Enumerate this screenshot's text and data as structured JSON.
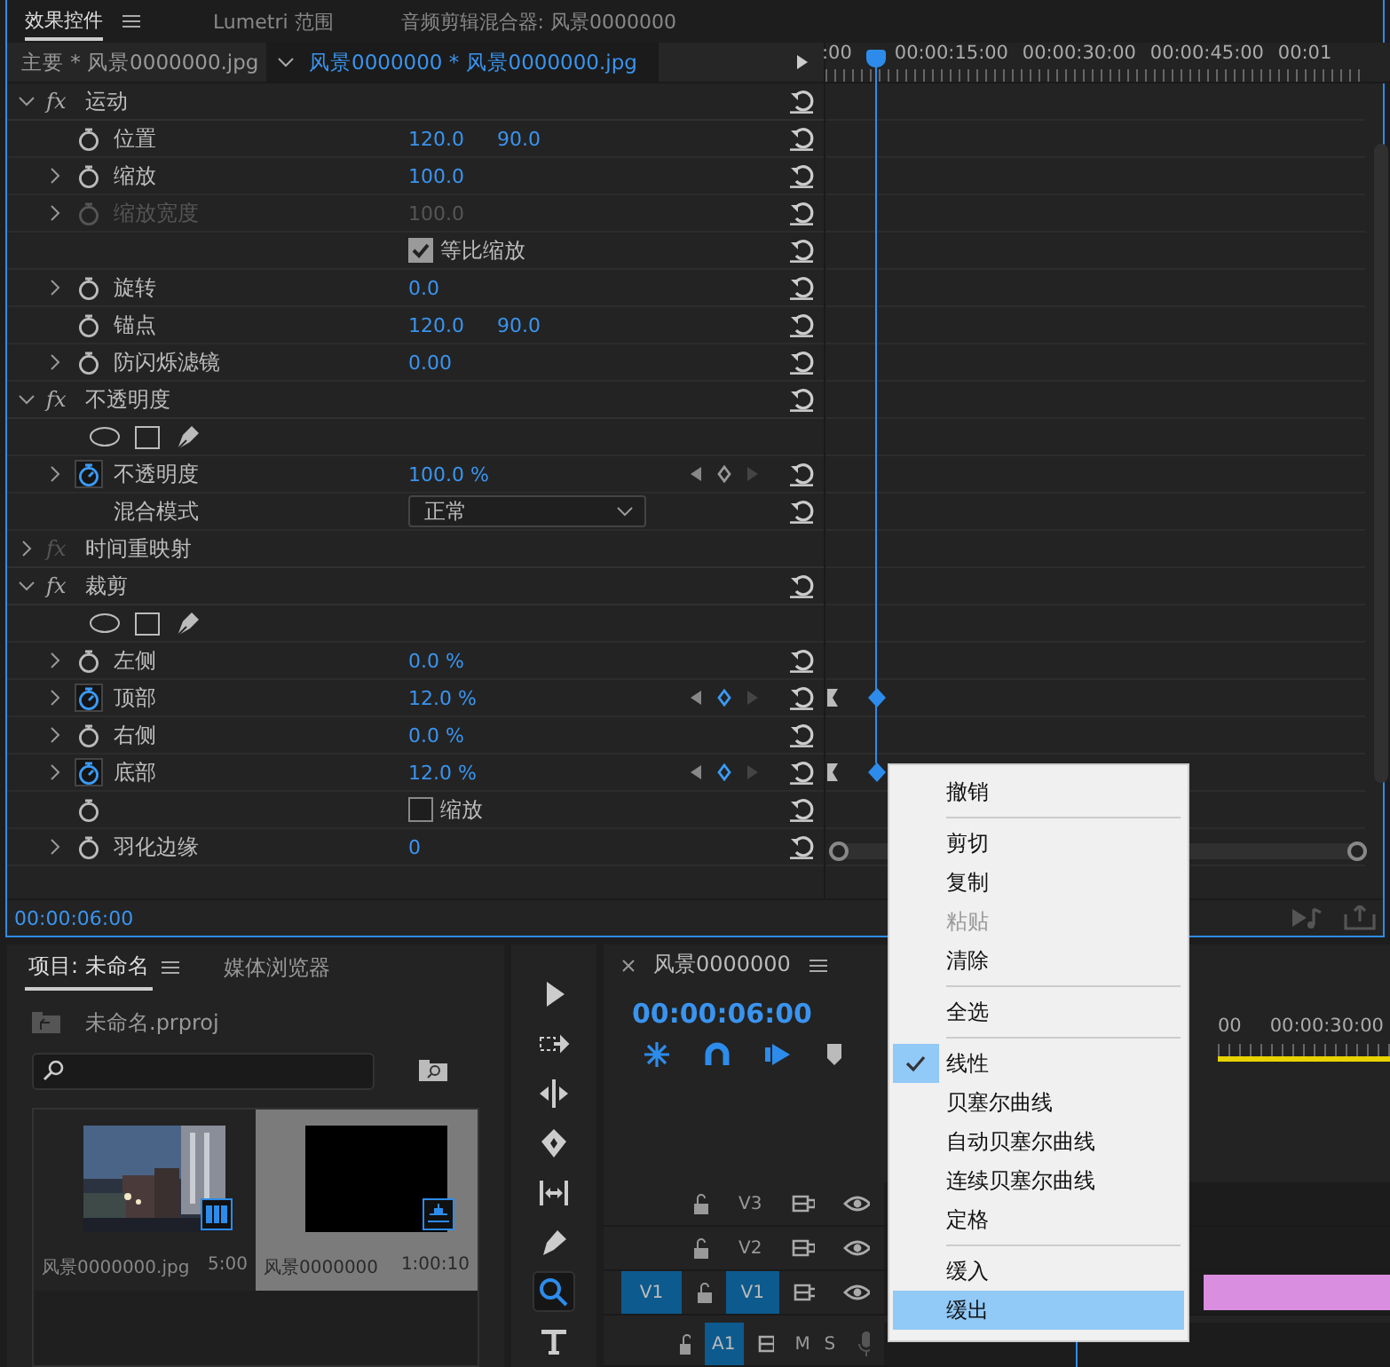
{
  "panel_tabs": [
    {
      "label": "效果控件",
      "selected": true
    },
    {
      "label": "Lumetri 范围",
      "selected": false
    },
    {
      "label": "音频剪辑混合器: 风景0000000",
      "selected": false
    }
  ],
  "clip_header": {
    "master": "主要 * 风景0000000.jpg",
    "sequence": "风景0000000 * 风景0000000.jpg"
  },
  "ruler": [
    ":00",
    "00:00:15:00",
    "00:00:30:00",
    "00:00:45:00",
    "00:01"
  ],
  "effects": [
    {
      "kind": "header",
      "label": "运动",
      "fx": "fx",
      "fx_enabled": true,
      "expanded": true,
      "reset": true
    },
    {
      "kind": "param",
      "label": "位置",
      "values": [
        "120.0",
        "90.0"
      ],
      "expandable": false,
      "animated": false,
      "disabled": false,
      "keyframes": false,
      "at_keyframe": false,
      "reset": true
    },
    {
      "kind": "param",
      "label": "缩放",
      "values": [
        "100.0"
      ],
      "expandable": true,
      "animated": false,
      "disabled": false,
      "keyframes": false,
      "at_keyframe": false,
      "reset": true
    },
    {
      "kind": "param",
      "label": "缩放宽度",
      "values": [
        "100.0"
      ],
      "expandable": true,
      "animated": false,
      "disabled": true,
      "keyframes": false,
      "at_keyframe": false,
      "reset": true
    },
    {
      "kind": "checkbox",
      "label": "等比缩放",
      "checked": true,
      "stopwatch": false,
      "reset": true
    },
    {
      "kind": "param",
      "label": "旋转",
      "values": [
        "0.0"
      ],
      "expandable": true,
      "animated": false,
      "disabled": false,
      "keyframes": false,
      "at_keyframe": false,
      "reset": true
    },
    {
      "kind": "param",
      "label": "锚点",
      "values": [
        "120.0",
        "90.0"
      ],
      "expandable": false,
      "animated": false,
      "disabled": false,
      "keyframes": false,
      "at_keyframe": false,
      "reset": true
    },
    {
      "kind": "param",
      "label": "防闪烁滤镜",
      "values": [
        "0.00"
      ],
      "expandable": true,
      "animated": false,
      "disabled": false,
      "keyframes": false,
      "at_keyframe": false,
      "reset": true
    },
    {
      "kind": "header",
      "label": "不透明度",
      "fx": "fx",
      "fx_enabled": true,
      "expanded": true,
      "reset": true
    },
    {
      "kind": "masks"
    },
    {
      "kind": "param",
      "label": "不透明度",
      "values": [
        "100.0 %"
      ],
      "expandable": true,
      "animated": true,
      "disabled": false,
      "keyframes": true,
      "at_keyframe": false,
      "reset": true
    },
    {
      "kind": "dropdown",
      "label": "混合模式",
      "value": "正常",
      "reset": true
    },
    {
      "kind": "header",
      "label": "时间重映射",
      "fx": "fx",
      "fx_enabled": false,
      "expanded": false
    },
    {
      "kind": "header",
      "label": "裁剪",
      "fx": "fx",
      "fx_enabled": true,
      "expanded": true,
      "reset": true
    },
    {
      "kind": "masks"
    },
    {
      "kind": "param",
      "label": "左侧",
      "values": [
        "0.0 %"
      ],
      "expandable": true,
      "animated": false,
      "disabled": false,
      "keyframes": false,
      "at_keyframe": false,
      "reset": true
    },
    {
      "kind": "param",
      "label": "顶部",
      "values": [
        "12.0 %"
      ],
      "expandable": true,
      "animated": true,
      "disabled": false,
      "keyframes": true,
      "at_keyframe": true,
      "reset": true
    },
    {
      "kind": "param",
      "label": "右侧",
      "values": [
        "0.0 %"
      ],
      "expandable": true,
      "animated": false,
      "disabled": false,
      "keyframes": false,
      "at_keyframe": false,
      "reset": true
    },
    {
      "kind": "param",
      "label": "底部",
      "values": [
        "12.0 %"
      ],
      "expandable": true,
      "animated": true,
      "disabled": false,
      "keyframes": true,
      "at_keyframe": true,
      "reset": true
    },
    {
      "kind": "checkbox",
      "label": "缩放",
      "checked": false,
      "stopwatch": true,
      "reset": true
    },
    {
      "kind": "param",
      "label": "羽化边缘",
      "values": [
        "0"
      ],
      "expandable": true,
      "animated": false,
      "disabled": false,
      "keyframes": false,
      "at_keyframe": false,
      "reset": true
    }
  ],
  "current_time": "00:00:06:00",
  "project": {
    "tabs": [
      {
        "label": "项目: 未命名",
        "selected": true
      },
      {
        "label": "媒体浏览器",
        "selected": false
      }
    ],
    "file": "未命名.prproj",
    "items": [
      {
        "name": "风景0000000.jpg",
        "duration": "5:00",
        "selected": false
      },
      {
        "kind": "sequence",
        "name": "风景0000000",
        "duration": "1:00:10",
        "selected": true
      }
    ]
  },
  "tools": [
    {
      "kind": "selection",
      "selected": false
    },
    {
      "kind": "track-select",
      "selected": false
    },
    {
      "kind": "ripple",
      "selected": false
    },
    {
      "kind": "razor",
      "selected": false
    },
    {
      "kind": "slip",
      "selected": false
    },
    {
      "kind": "pen",
      "selected": false
    },
    {
      "kind": "zoom",
      "selected": true
    },
    {
      "kind": "type",
      "selected": false
    }
  ],
  "timeline": {
    "tab": "风景0000000",
    "timecode": "00:00:06:00",
    "ruler": [
      "00",
      "00:00:30:00"
    ],
    "tracks": [
      {
        "kind": "video",
        "name": "V3",
        "targeted": false
      },
      {
        "kind": "video",
        "name": "V2",
        "targeted": false
      },
      {
        "kind": "video",
        "name": "V1",
        "targeted": true,
        "source_patch": "V1",
        "clip": true
      },
      {
        "kind": "audio",
        "name": "A1",
        "targeted": true,
        "mute": "M",
        "solo": "S"
      }
    ]
  },
  "context_menu": [
    {
      "kind": "item",
      "label": "撤销",
      "checked": false,
      "disabled": false,
      "selected": false
    },
    {
      "kind": "separator"
    },
    {
      "kind": "item",
      "label": "剪切",
      "checked": false,
      "disabled": false,
      "selected": false
    },
    {
      "kind": "item",
      "label": "复制",
      "checked": false,
      "disabled": false,
      "selected": false
    },
    {
      "kind": "item",
      "label": "粘贴",
      "checked": false,
      "disabled": true,
      "selected": false
    },
    {
      "kind": "item",
      "label": "清除",
      "checked": false,
      "disabled": false,
      "selected": false
    },
    {
      "kind": "separator"
    },
    {
      "kind": "item",
      "label": "全选",
      "checked": false,
      "disabled": false,
      "selected": false
    },
    {
      "kind": "separator"
    },
    {
      "kind": "item",
      "label": "线性",
      "checked": true,
      "disabled": false,
      "selected": false
    },
    {
      "kind": "item",
      "label": "贝塞尔曲线",
      "checked": false,
      "disabled": false,
      "selected": false
    },
    {
      "kind": "item",
      "label": "自动贝塞尔曲线",
      "checked": false,
      "disabled": false,
      "selected": false
    },
    {
      "kind": "item",
      "label": "连续贝塞尔曲线",
      "checked": false,
      "disabled": false,
      "selected": false
    },
    {
      "kind": "item",
      "label": "定格",
      "checked": false,
      "disabled": false,
      "selected": false
    },
    {
      "kind": "separator"
    },
    {
      "kind": "item",
      "label": "缓入",
      "checked": false,
      "disabled": false,
      "selected": false
    },
    {
      "kind": "item",
      "label": "缓出",
      "checked": false,
      "disabled": false,
      "selected": true
    }
  ]
}
